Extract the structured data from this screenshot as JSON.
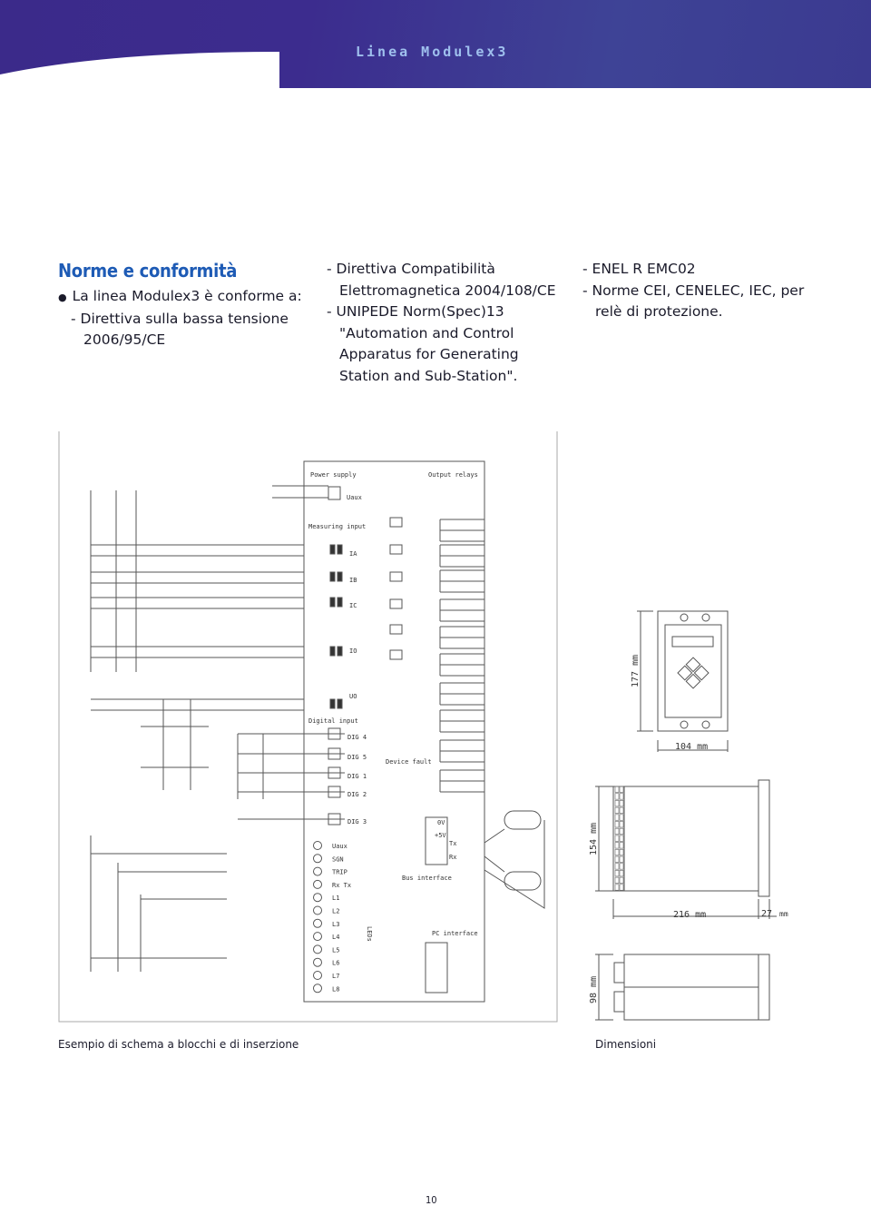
{
  "header": {
    "title": "Linea Modulex3",
    "colors": {
      "banner": "#3b2a8a",
      "title_text": "#9fc0ee",
      "heading": "#1e5bb5"
    }
  },
  "section": {
    "heading": "Norme e conformità",
    "col1": [
      "La linea Modulex3 è conforme a:",
      "- Direttiva sulla bassa tensione",
      "2006/95/CE"
    ],
    "col2": [
      "- Direttiva Compatibilità",
      "Elettromagnetica 2004/108/CE",
      "- UNIPEDE Norm(Spec)13",
      "\"Automation and Control",
      "Apparatus for Generating",
      "Station and Sub-Station\"."
    ],
    "col3": [
      "- ENEL R EMC02",
      "- Norme CEI, CENELEC, IEC, per",
      "relè di protezione."
    ]
  },
  "schematic": {
    "power_supply": "Power supply",
    "uaux": "Uaux",
    "measuring_input": "Measuring input",
    "inputs": [
      "IA",
      "IB",
      "IC",
      "IO",
      "UO"
    ],
    "output_relays": "Output relays",
    "digital_input": "Digital input",
    "digital": [
      "DIG 4",
      "DIG 5",
      "DIG 1",
      "DIG 2",
      "DIG 3"
    ],
    "device_fault": "Device fault",
    "bus_interface": "Bus interface",
    "pc_interface": "PC interface",
    "leds_label": "LEDs",
    "leds": [
      "Uaux",
      "SGN",
      "TRIP",
      "Rx Tx",
      "L1",
      "L2",
      "L3",
      "L4",
      "L5",
      "L6",
      "L7",
      "L8"
    ],
    "bus_pins": [
      "0V",
      "+5V",
      "Tx",
      "Rx"
    ]
  },
  "dimensions": {
    "height_front": "177 mm",
    "width_front": "104 mm",
    "height_side": "154 mm",
    "depth": "216 mm",
    "depth_front": "27",
    "depth_front_unit": "mm",
    "height_top": "98 mm"
  },
  "captions": {
    "left": "Esempio di schema a blocchi e di inserzione",
    "right": "Dimensioni"
  },
  "page_number": "10"
}
